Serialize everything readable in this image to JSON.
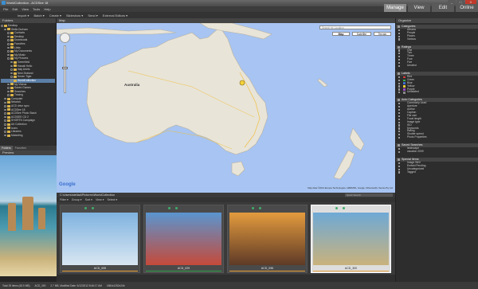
{
  "window": {
    "title": "WorldCollection - ACDSee 18",
    "controls": [
      "_",
      "□",
      "X"
    ]
  },
  "menu": [
    "File",
    "Edit",
    "View",
    "Tools",
    "Help"
  ],
  "modes": [
    {
      "label": "Manage",
      "active": true
    },
    {
      "label": "View"
    },
    {
      "label": "Edit"
    },
    {
      "label": "Online"
    }
  ],
  "toolbar": [
    "Import ▾",
    "Batch ▾",
    "Create ▾",
    "Slideshow ▾",
    "Send ▾",
    "External Editors ▾"
  ],
  "folders": {
    "title": "Folders",
    "items": [
      {
        "label": "Desktop",
        "indent": 0
      },
      {
        "label": "Stella Durham",
        "indent": 1
      },
      {
        "label": "Contacts",
        "indent": 2
      },
      {
        "label": "Desktop",
        "indent": 2
      },
      {
        "label": "Downloads",
        "indent": 2
      },
      {
        "label": "Favorites",
        "indent": 2
      },
      {
        "label": "Links",
        "indent": 2
      },
      {
        "label": "My Documents",
        "indent": 2
      },
      {
        "label": "My Music",
        "indent": 2
      },
      {
        "label": "My Pictures",
        "indent": 2
      },
      {
        "label": "Greenfield",
        "indent": 3
      },
      {
        "label": "Hawaii Hello",
        "indent": 3
      },
      {
        "label": "Italy Arrets",
        "indent": 3
      },
      {
        "label": "New Zealand",
        "indent": 3
      },
      {
        "label": "Seven Tiger",
        "indent": 3
      },
      {
        "label": "WorldCollection",
        "indent": 3,
        "selected": true
      },
      {
        "label": "My Videos",
        "indent": 2
      },
      {
        "label": "Saved Games",
        "indent": 2
      },
      {
        "label": "Searches",
        "indent": 2
      },
      {
        "label": "Tracing",
        "indent": 2
      },
      {
        "label": "Computer",
        "indent": 1
      },
      {
        "label": "Network",
        "indent": 1
      },
      {
        "label": "ACD drive sync",
        "indent": 1
      },
      {
        "label": "ACDSee 18",
        "indent": 1
      },
      {
        "label": "ACDSee Photo Stash",
        "indent": 1
      },
      {
        "label": "ACDSEE CD 2",
        "indent": 1
      },
      {
        "label": "SHORTN Campaign",
        "indent": 1
      },
      {
        "label": "Art Collection",
        "indent": 1
      },
      {
        "label": "Icons",
        "indent": 1
      },
      {
        "label": "Libraries",
        "indent": 1
      },
      {
        "label": "Marketing",
        "indent": 1
      }
    ],
    "tabs": [
      {
        "label": "Folders",
        "active": true
      },
      {
        "label": "Favorites",
        "active": false
      }
    ]
  },
  "preview": {
    "title": "Preview"
  },
  "map": {
    "title": "Map",
    "search_placeholder": "Search for Location",
    "types": [
      "Map",
      "Satellite",
      "Terrain"
    ],
    "labels": {
      "country": "Australia",
      "brand": "Google",
      "copyright": "Map data ©2014 Europa Technologies, GBRMPA, Google, Whereis(R), Sensis Pty Ltd"
    }
  },
  "browser": {
    "path": "C:\\Users\\stellad\\Pictures\\WorldCollection",
    "quicksearch": "Quick Search",
    "filters": [
      "Filter ▾",
      "Group ▾",
      "Sort ▾",
      "View ▾",
      "Select ▾"
    ],
    "thumbnails": [
      {
        "caption": "ACD_005",
        "bar": "#e8a13a",
        "colors": [
          "#7fb2e0",
          "#d9e7f2"
        ],
        "selected": false
      },
      {
        "caption": "ACD_029",
        "bar": "#2fa04a",
        "colors": [
          "#5a95cf",
          "#c54a3a"
        ],
        "selected": false
      },
      {
        "caption": "ACD_096",
        "bar": "#e8a13a",
        "colors": [
          "#e39b3e",
          "#5e3a26"
        ],
        "selected": false
      },
      {
        "caption": "ACD_300",
        "bar": "#e8a13a",
        "colors": [
          "#6ea9d6",
          "#c9b27c"
        ],
        "selected": true
      }
    ]
  },
  "status": [
    "Total 25 items (63.5 MB)",
    "ACD_300",
    "2.7 MB, Modified Date: 6/12/2012 8:46:17 AM",
    "1884x1252x24b"
  ],
  "organize": {
    "title": "Organize",
    "sections": [
      {
        "title": "Categories",
        "items": [
          {
            "label": "Albums"
          },
          {
            "label": "People"
          },
          {
            "label": "Places"
          },
          {
            "label": "Various"
          }
        ]
      },
      {
        "title": "Ratings",
        "items": [
          {
            "label": "One"
          },
          {
            "label": "Two"
          },
          {
            "label": "Three"
          },
          {
            "label": "Four"
          },
          {
            "label": "Five"
          },
          {
            "label": "Unrated"
          }
        ]
      },
      {
        "title": "Labels",
        "items": [
          {
            "label": "Red",
            "color": "#d23b3b"
          },
          {
            "label": "Green",
            "color": "#3cab4a"
          },
          {
            "label": "Blue",
            "color": "#3a6cd2"
          },
          {
            "label": "Yellow",
            "color": "#e5c93a"
          },
          {
            "label": "Purple",
            "color": "#9b49c7"
          },
          {
            "label": "Unlabeled",
            "color": "#888888"
          }
        ]
      },
      {
        "title": "Auto Categories",
        "items": [
          {
            "label": "Commonly Used"
          },
          {
            "label": "Aperture"
          },
          {
            "label": "Author"
          },
          {
            "label": "Caption"
          },
          {
            "label": "File size"
          },
          {
            "label": "Focal length"
          },
          {
            "label": "Image type"
          },
          {
            "label": "ISO"
          },
          {
            "label": "Keywords"
          },
          {
            "label": "Rating"
          },
          {
            "label": "Shutter speed"
          },
          {
            "label": "Photo Properties"
          }
        ]
      },
      {
        "title": "Saved Searches",
        "items": [
          {
            "label": "landscape"
          },
          {
            "label": "vacation 2009"
          }
        ]
      },
      {
        "title": "Special Items",
        "items": [
          {
            "label": "Image Well"
          },
          {
            "label": "Embed Pending"
          },
          {
            "label": "Uncategorized"
          },
          {
            "label": "Tagged"
          }
        ]
      }
    ]
  }
}
